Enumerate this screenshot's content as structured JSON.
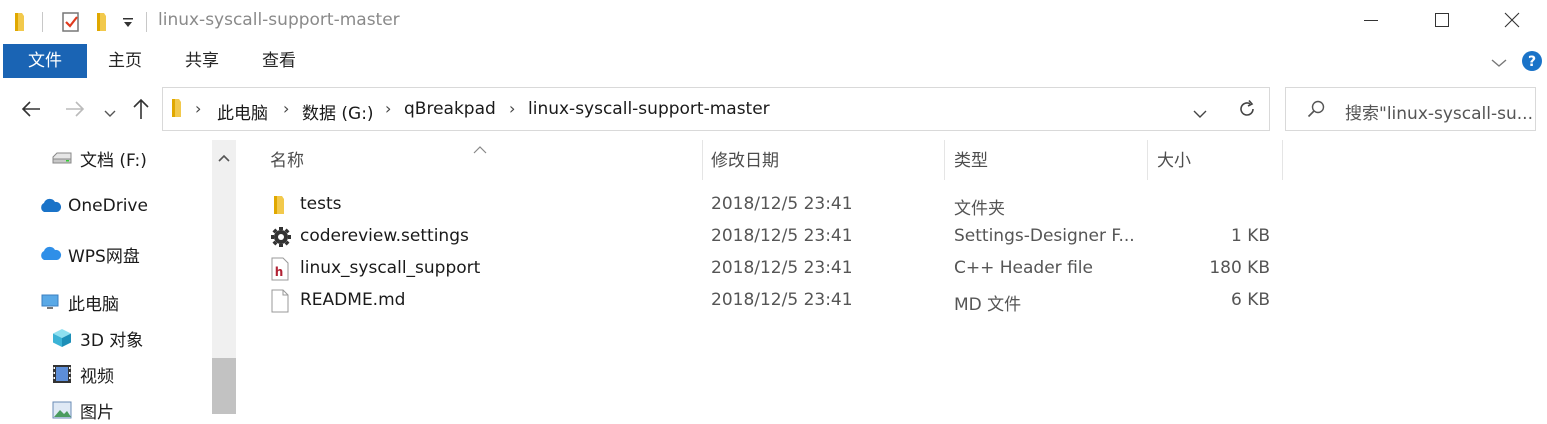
{
  "window": {
    "title": "linux-syscall-support-master"
  },
  "ribbon": {
    "tabs": [
      {
        "label": "文件"
      },
      {
        "label": "主页"
      },
      {
        "label": "共享"
      },
      {
        "label": "查看"
      }
    ]
  },
  "address": {
    "crumbs": [
      "此电脑",
      "数据 (G:)",
      "qBreakpad",
      "linux-syscall-support-master"
    ]
  },
  "search": {
    "placeholder": "搜索\"linux-syscall-su..."
  },
  "sidebar": {
    "items": [
      {
        "label": "文档 (F:)",
        "icon": "drive-icon"
      },
      {
        "label": "OneDrive",
        "icon": "cloud-icon"
      },
      {
        "label": "WPS网盘",
        "icon": "cloud-icon"
      },
      {
        "label": "此电脑",
        "icon": "computer-icon"
      },
      {
        "label": "3D 对象",
        "icon": "cube-icon"
      },
      {
        "label": "视频",
        "icon": "video-icon"
      },
      {
        "label": "图片",
        "icon": "image-icon"
      }
    ]
  },
  "columns": {
    "name": "名称",
    "modified": "修改日期",
    "type": "类型",
    "size": "大小"
  },
  "files": [
    {
      "name": "tests",
      "modified": "2018/12/5 23:41",
      "type": "文件夹",
      "size": "",
      "icon": "folder-icon"
    },
    {
      "name": "codereview.settings",
      "modified": "2018/12/5 23:41",
      "type": "Settings-Designer F...",
      "size": "1 KB",
      "icon": "gear-icon"
    },
    {
      "name": "linux_syscall_support",
      "modified": "2018/12/5 23:41",
      "type": "C++ Header file",
      "size": "180 KB",
      "icon": "header-file-icon"
    },
    {
      "name": "README.md",
      "modified": "2018/12/5 23:41",
      "type": "MD 文件",
      "size": "6 KB",
      "icon": "document-icon"
    }
  ],
  "colors": {
    "accent": "#1a64b4",
    "folder": "#f2c94c",
    "help": "#1a73c8"
  }
}
